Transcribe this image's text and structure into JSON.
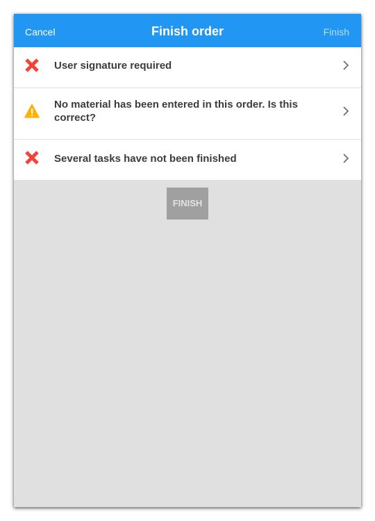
{
  "header": {
    "cancel_label": "Cancel",
    "title": "Finish order",
    "finish_label": "Finish"
  },
  "items": [
    {
      "status": "error",
      "icon": "error-x-icon",
      "text": "User signature required"
    },
    {
      "status": "warning",
      "icon": "warning-icon",
      "text": "No material has been entered in this order. Is this correct?"
    },
    {
      "status": "error",
      "icon": "error-x-icon",
      "text": "Several tasks have not been finished"
    }
  ],
  "finish_button": {
    "label": "FINISH"
  },
  "colors": {
    "header": "#2196f3",
    "error": "#f44336",
    "warning": "#ffb300",
    "background": "#e0e0e0",
    "button_disabled": "#a0a0a0"
  }
}
